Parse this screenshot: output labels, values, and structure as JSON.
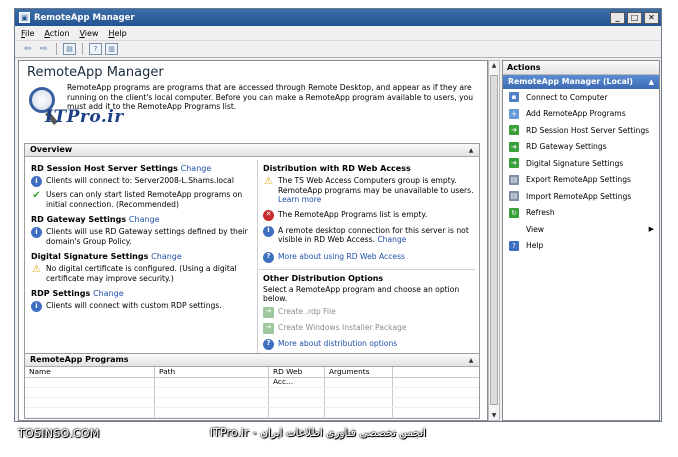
{
  "window": {
    "title": "RemoteApp Manager"
  },
  "menu": [
    "File",
    "Action",
    "View",
    "Help"
  ],
  "main": {
    "title": "RemoteApp Manager",
    "intro": "RemoteApp programs are programs that are accessed through Remote Desktop, and appear as if they are running on the client's local computer. Before you can make a RemoteApp program available to users, you must add it to the RemoteApp Programs list.",
    "logo_text": "ITPro.ir"
  },
  "overview": {
    "title": "Overview",
    "left": {
      "rdsh": {
        "title": "RD Session Host Server Settings",
        "change": "Change",
        "items": [
          {
            "icon": "info",
            "text": "Clients will connect to: Server2008-L.Shams.local"
          },
          {
            "icon": "ok",
            "text": "Users can only start listed RemoteApp programs on initial connection. (Recommended)"
          }
        ]
      },
      "gateway": {
        "title": "RD Gateway Settings",
        "change": "Change",
        "items": [
          {
            "icon": "info",
            "text": "Clients will use RD Gateway settings defined by their domain's Group Policy."
          }
        ]
      },
      "signature": {
        "title": "Digital Signature Settings",
        "change": "Change",
        "items": [
          {
            "icon": "warn",
            "text": "No digital certificate is configured. (Using a digital certificate may improve security.)"
          }
        ]
      },
      "rdp": {
        "title": "RDP Settings",
        "change": "Change",
        "items": [
          {
            "icon": "info",
            "text": "Clients will connect with custom RDP settings."
          }
        ]
      }
    },
    "right": {
      "web": {
        "title": "Distribution with RD Web Access",
        "warn1": "The TS Web Access Computers group is empty. RemoteApp programs may be unavailable to users.",
        "learn": "Learn more",
        "err": "The RemoteApp Programs list is empty.",
        "info": "A remote desktop connection for this server is not visible in RD Web Access.",
        "change": "Change",
        "more": "More about using RD Web Access"
      },
      "other": {
        "title": "Other Distribution Options",
        "desc": "Select a RemoteApp program and choose an option below.",
        "opt1": "Create .rdp File",
        "opt2": "Create Windows Installer Package",
        "more": "More about distribution options"
      }
    }
  },
  "programs": {
    "title": "RemoteApp Programs",
    "columns": [
      "Name",
      "Path",
      "RD Web Acc...",
      "Arguments"
    ]
  },
  "actions": {
    "title": "Actions",
    "group": "RemoteApp Manager (Local)",
    "items": [
      "Connect to Computer",
      "Add RemoteApp Programs",
      "RD Session Host Server Settings",
      "RD Gateway Settings",
      "Digital Signature Settings",
      "Export RemoteApp Settings",
      "Import RemoteApp Settings",
      "Refresh",
      "View",
      "Help"
    ]
  },
  "watermarks": {
    "left": "TOSINSO.COM",
    "right": "ITPro.ir - انجمن تخصصی فناوری اطلاعات ایران"
  }
}
